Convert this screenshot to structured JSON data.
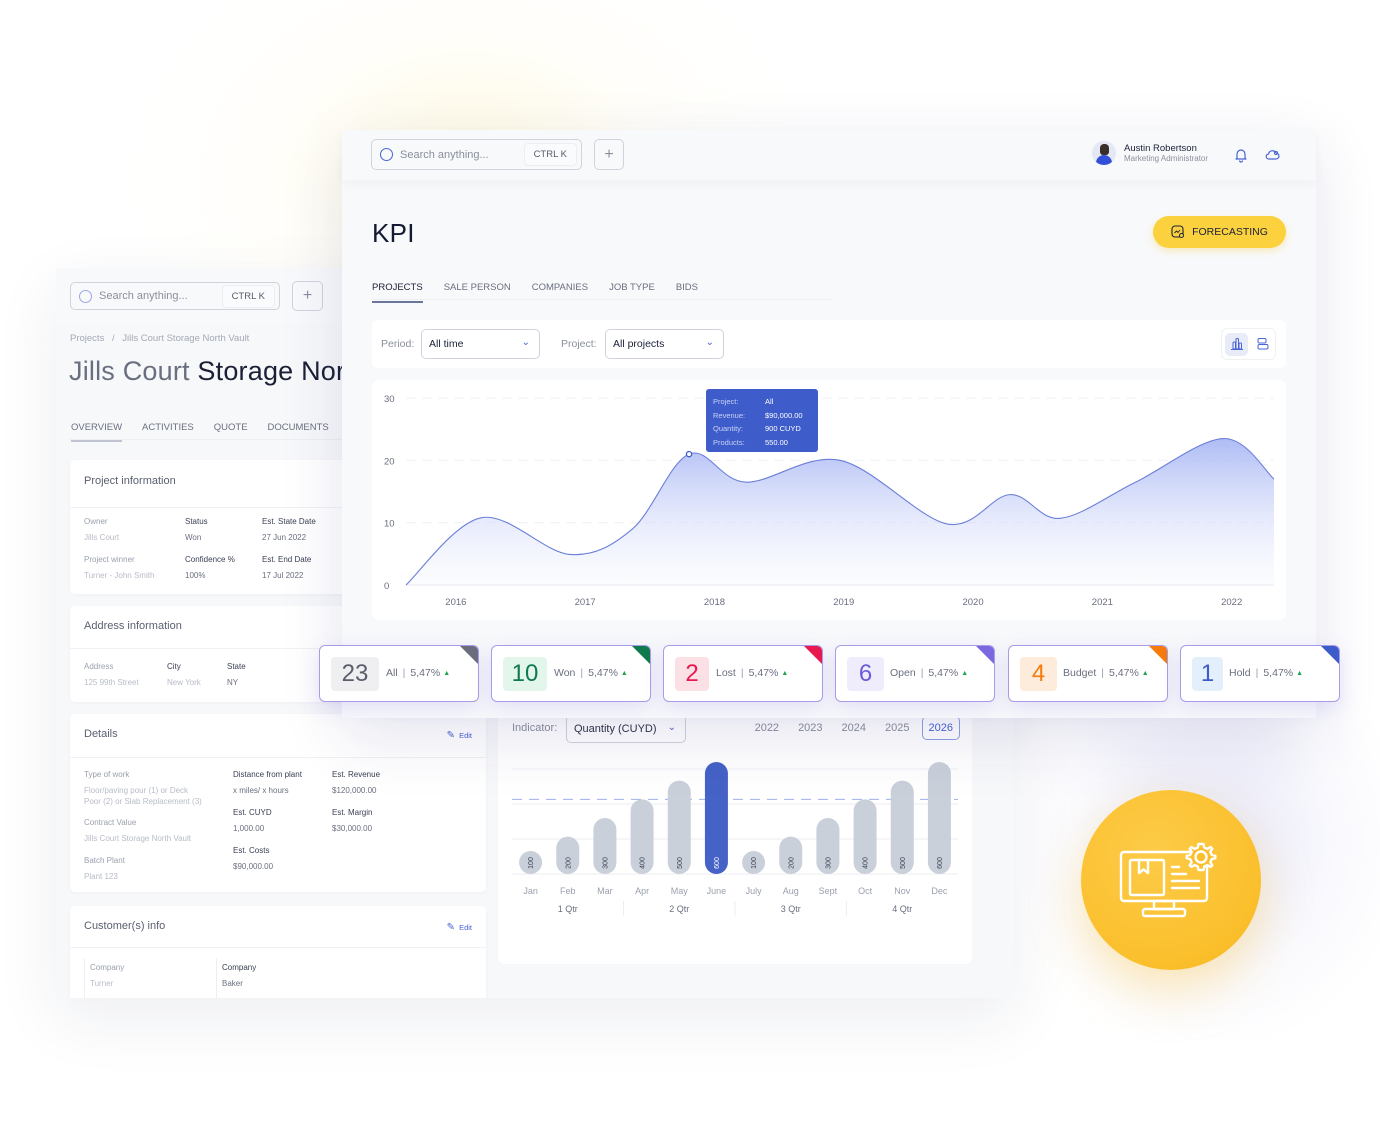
{
  "background_page": {
    "search": {
      "placeholder": "Search anything...",
      "shortcut": "CTRL K",
      "add_label": "+"
    },
    "breadcrumb": [
      "Projects",
      "/",
      "Jills Court Storage North Vault"
    ],
    "title": {
      "muted": "Jills Court",
      "main": " Storage North Vault"
    },
    "tabs": [
      "OVERVIEW",
      "ACTIVITIES",
      "QUOTE",
      "DOCUMENTS"
    ],
    "project_information": {
      "title": "Project information",
      "fields": [
        {
          "label": "Owner",
          "value": "Jills Court"
        },
        {
          "label": "Status",
          "value": "Won"
        },
        {
          "label": "Est. State Date",
          "value": "27 Jun 2022"
        },
        {
          "label": "Project winner",
          "value": "Turner - John Smith"
        },
        {
          "label": "Confidence %",
          "value": "100%"
        },
        {
          "label": "Est. End Date",
          "value": "17 Jul 2022"
        }
      ]
    },
    "address_information": {
      "title": "Address information",
      "fields": [
        {
          "label": "Address",
          "value": "125 99th Street"
        },
        {
          "label": "City",
          "value": "New York"
        },
        {
          "label": "State",
          "value": "NY"
        }
      ]
    },
    "details": {
      "title": "Details",
      "edit_label": "Edit",
      "fields": [
        {
          "label": "Type of work",
          "value": "Floor/paving pour (1) or Deck\nPoor (2) or Slab Replacement (3)"
        },
        {
          "label": "Contract Value",
          "value": "Jills Court Storage North Vault"
        },
        {
          "label": "Batch Plant",
          "value": "Plant 123"
        },
        {
          "label": "Distance from plant",
          "value": "x miles/ x hours"
        },
        {
          "label": "Est. CUYD",
          "value": "1,000.00"
        },
        {
          "label": "Est. Costs",
          "value": "$90,000.00"
        },
        {
          "label": "Est. Revenue",
          "value": "$120,000.00"
        },
        {
          "label": "Est. Margin",
          "value": "$30,000.00"
        }
      ]
    },
    "customers_info": {
      "title": "Customer(s) info",
      "edit_label": "Edit",
      "fields": [
        {
          "label": "Company",
          "value": "Turner"
        },
        {
          "label": "Company",
          "value": "Baker"
        }
      ]
    },
    "bar_panel": {
      "indicator_label": "Indicator:",
      "indicator_value": "Quantity (CUYD)",
      "years": [
        "2022",
        "2023",
        "2024",
        "2025",
        "2026"
      ],
      "active_year": "2026"
    }
  },
  "kpi_page": {
    "search": {
      "placeholder": "Search anything...",
      "shortcut": "CTRL K",
      "add_label": "+"
    },
    "user": {
      "name": "Austin Robertson",
      "role": "Marketing Administrator"
    },
    "icons": {
      "notifications": "bell-icon",
      "settings": "cloud-gear-icon",
      "forecast": "forecast-chart-icon"
    },
    "title": "KPI",
    "forecast_button": "FORECASTING",
    "tabs": [
      "PROJECTS",
      "SALE PERSON",
      "COMPANIES",
      "JOB TYPE",
      "BIDS"
    ],
    "active_tab": "PROJECTS",
    "filters": {
      "period_label": "Period:",
      "period_value": "All time",
      "project_label": "Project:",
      "project_value": "All projects"
    },
    "tooltip": [
      {
        "k": "Project:",
        "v": "All"
      },
      {
        "k": "Revenue:",
        "v": "$90,000.00"
      },
      {
        "k": "Quantity:",
        "v": "900 CUYD"
      },
      {
        "k": "Products:",
        "v": "550.00"
      }
    ],
    "stats": [
      {
        "value": "23",
        "label": "All",
        "change": "5,47%",
        "color": "#6b6d7d",
        "bg": "#efeff1",
        "fg": "#5a5d6b"
      },
      {
        "value": "10",
        "label": "Won",
        "change": "5,47%",
        "color": "#0e7a4d",
        "bg": "#e3f6ec",
        "fg": "#0e7a4d"
      },
      {
        "value": "2",
        "label": "Lost",
        "change": "5,47%",
        "color": "#e8194f",
        "bg": "#fbe0e6",
        "fg": "#e8194f"
      },
      {
        "value": "6",
        "label": "Open",
        "change": "5,47%",
        "color": "#7b68e0",
        "bg": "#efedfc",
        "fg": "#6a5bd9"
      },
      {
        "value": "4",
        "label": "Budget",
        "change": "5,47%",
        "color": "#f57b0c",
        "bg": "#fdebdb",
        "fg": "#f57b0c"
      },
      {
        "value": "1",
        "label": "Hold",
        "change": "5,47%",
        "color": "#3d5ccc",
        "bg": "#e4effc",
        "fg": "#3d5ccc"
      }
    ]
  },
  "colors": {
    "accent": "#4a63d6",
    "forecast_yellow": "#fbd13d",
    "badge_yellow": "#fbbf2c",
    "bar_default": "#c9d0da",
    "bar_highlight": "#4562c6"
  },
  "chart_data": [
    {
      "type": "area",
      "title": "",
      "xlabel": "",
      "ylabel": "",
      "x_ticks": [
        "2016",
        "2017",
        "2018",
        "2019",
        "2020",
        "2021",
        "2022"
      ],
      "y_ticks": [
        0,
        10,
        20,
        30
      ],
      "ylim": [
        0,
        30
      ],
      "grid": true,
      "x": [
        2015.4,
        2016.0,
        2016.7,
        2017.2,
        2017.65,
        2018.1,
        2018.85,
        2019.7,
        2020.2,
        2020.6,
        2021.2,
        2021.9,
        2022.3
      ],
      "values": [
        0,
        10.8,
        4.9,
        9,
        21,
        16.5,
        20,
        9.8,
        14.5,
        10.7,
        16.5,
        23.5,
        17
      ],
      "highlight_point": {
        "x": 2017.65,
        "y": 21
      }
    },
    {
      "type": "bar",
      "title": "",
      "categories": [
        "Jan",
        "Feb",
        "Mar",
        "Apr",
        "May",
        "June",
        "July",
        "Aug",
        "Sept",
        "Oct",
        "Nov",
        "Dec"
      ],
      "values": [
        100,
        200,
        300,
        400,
        500,
        600,
        100,
        200,
        300,
        400,
        500,
        600
      ],
      "highlighted": "June",
      "groups": [
        "1 Qtr",
        "2 Qtr",
        "3 Qtr",
        "4 Qtr"
      ],
      "reference_line": 400,
      "ylim": [
        0,
        600
      ]
    }
  ]
}
